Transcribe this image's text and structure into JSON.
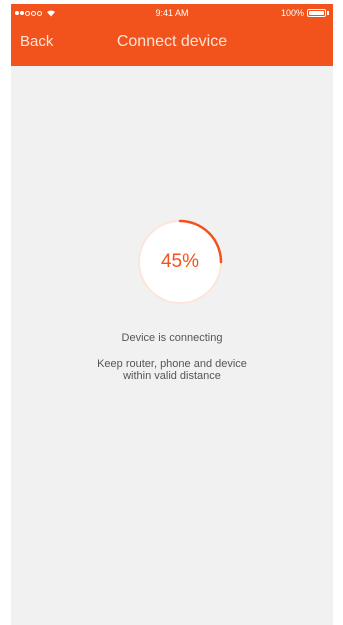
{
  "status_bar": {
    "signal_icon": "signal-dots-icon",
    "wifi_icon": "wifi-icon",
    "time": "9:41 AM",
    "battery_percent": "100%",
    "battery_icon": "battery-icon"
  },
  "nav": {
    "back_label": "Back",
    "title": "Connect device"
  },
  "progress": {
    "percent_label": "45%",
    "value": 0.45
  },
  "messages": {
    "status": "Device is connecting",
    "hint_line1": "Keep router, phone and device",
    "hint_line2": "within valid distance"
  },
  "colors": {
    "accent": "#f2531c",
    "background": "#f1f1f1",
    "ring_bg": "#fcece4"
  }
}
